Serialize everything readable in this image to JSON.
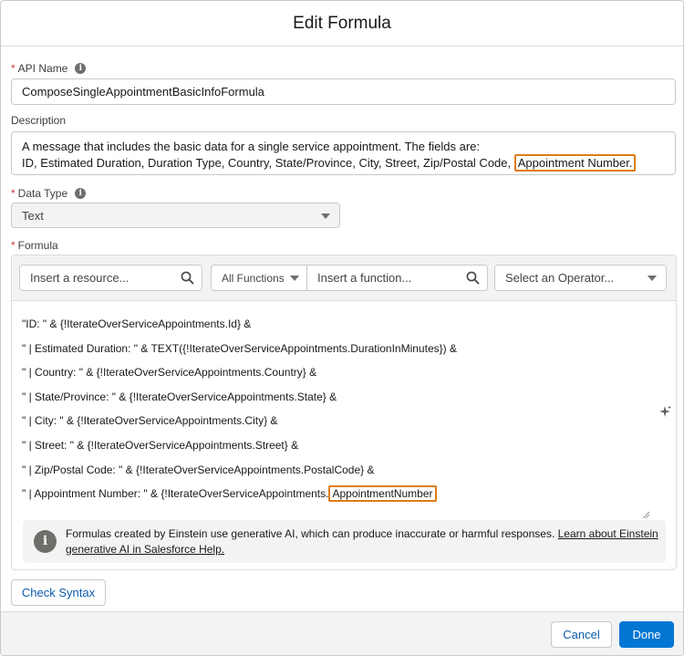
{
  "modal": {
    "title": "Edit Formula"
  },
  "api_name": {
    "label": "API Name",
    "required_marker": "*",
    "value": "ComposeSingleAppointmentBasicInfoFormula"
  },
  "description": {
    "label": "Description",
    "line1": "A message that includes the basic data for a single service appointment. The fields are:",
    "line2_prefix": "ID, Estimated Duration, Duration Type, Country, State/Province, City, Street, Zip/Postal Code,",
    "line2_highlight": "Appointment Number."
  },
  "data_type": {
    "label": "Data Type",
    "required_marker": "*",
    "value": "Text"
  },
  "formula": {
    "label": "Formula",
    "required_marker": "*",
    "resource_placeholder": "Insert a resource...",
    "functions_select": "All Functions",
    "function_placeholder": "Insert a function...",
    "operator_placeholder": "Select an Operator...",
    "lines": [
      "\"ID: \" & {!IterateOverServiceAppointments.Id} &",
      "\" | Estimated Duration: \" & TEXT({!IterateOverServiceAppointments.DurationInMinutes}) &",
      "\" | Country: \" & {!IterateOverServiceAppointments.Country} &",
      "\" | State/Province: \" & {!IterateOverServiceAppointments.State} &",
      "\" | City: \" & {!IterateOverServiceAppointments.City} &",
      "\" | Street: \" & {!IterateOverServiceAppointments.Street} &",
      "\" | Zip/Postal Code: \" & {!IterateOverServiceAppointments.PostalCode} &"
    ],
    "last_line_prefix": "\" | Appointment Number: \" & {!IterateOverServiceAppointments.",
    "last_line_highlight": "AppointmentNumber"
  },
  "notice": {
    "text": "Formulas created by Einstein use generative AI, which can produce inaccurate or harmful responses.",
    "link": "Learn about Einstein generative AI in Salesforce Help."
  },
  "buttons": {
    "check_syntax": "Check Syntax",
    "cancel": "Cancel",
    "done": "Done"
  },
  "colors": {
    "brand": "#0176d3",
    "highlight": "#e07b17",
    "required": "#c23934"
  },
  "icons": [
    "info-icon",
    "search-icon",
    "chevron-down-icon",
    "sparkle-icon",
    "info-circle-icon"
  ]
}
